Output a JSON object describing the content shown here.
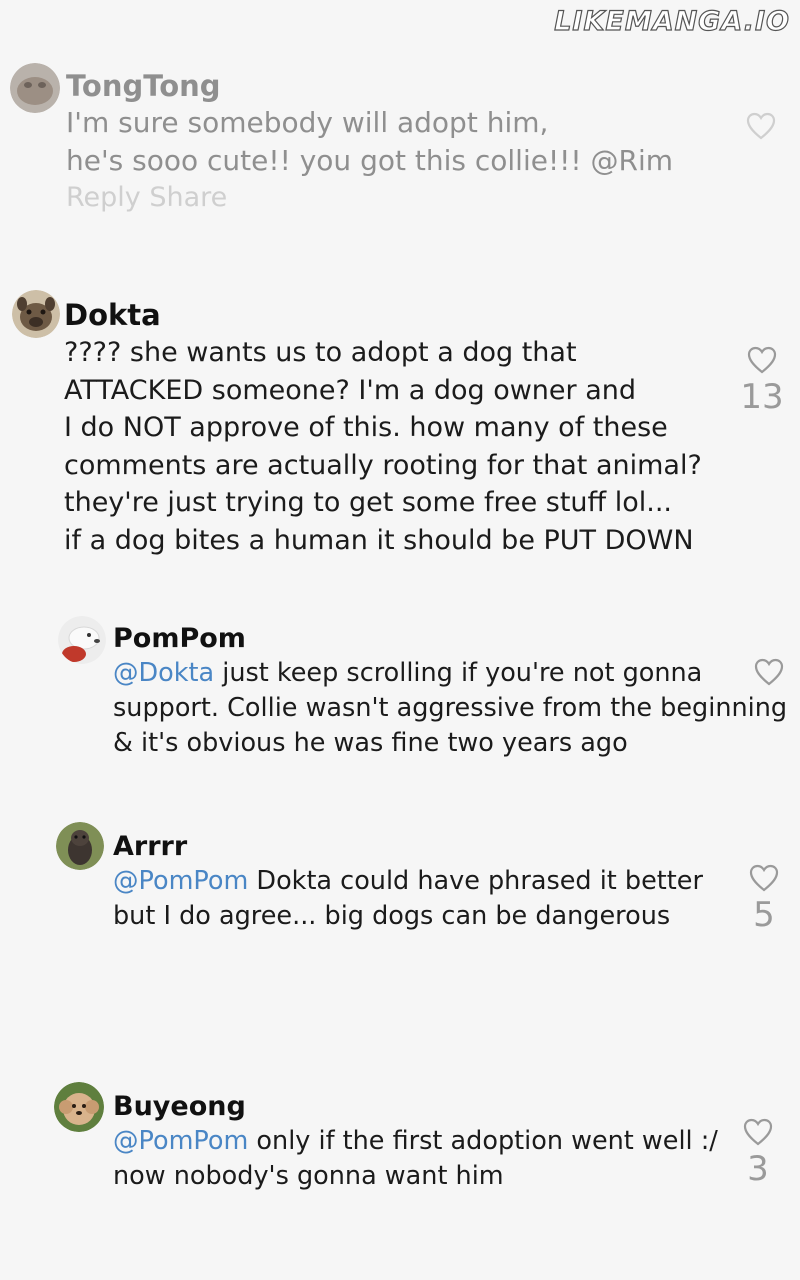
{
  "watermark": "LIKEMANGA.IO",
  "comments": [
    {
      "username": "TongTong",
      "lines": [
        "I'm sure somebody will adopt him,",
        "he's sooo cute!! you got this collie!!! @Rim"
      ],
      "actions": {
        "reply": "Reply",
        "share": "Share"
      },
      "likes": ""
    },
    {
      "username": "Dokta",
      "lines": [
        "???? she wants us to adopt a dog that",
        "ATTACKED someone? I'm a dog owner and",
        "I do NOT approve of this. how many of these",
        "comments are actually rooting for that animal?",
        "they're just trying to get some free stuff lol...",
        "if a dog bites a human it should be PUT DOWN"
      ],
      "likes": "13"
    },
    {
      "username": "PomPom",
      "mention": "@Dokta",
      "lines": [
        " just keep scrolling if you're not gonna",
        "support. Collie wasn't aggressive from the beginning",
        "& it's obvious he was fine two years ago"
      ],
      "likes": ""
    },
    {
      "username": "Arrrr",
      "mention": "@PomPom",
      "lines": [
        " Dokta could have phrased it better",
        "but I do agree... big dogs can be dangerous"
      ],
      "likes": "5"
    },
    {
      "username": "Buyeong",
      "mention": "@PomPom",
      "lines": [
        " only if the first adoption went well :/",
        "now nobody's gonna want him"
      ],
      "likes": "3"
    }
  ],
  "colors": {
    "background": "#f6f6f6",
    "mention": "#4a86c5",
    "faded_text": "#8f8f8f",
    "heart": "#9a9a9a"
  }
}
